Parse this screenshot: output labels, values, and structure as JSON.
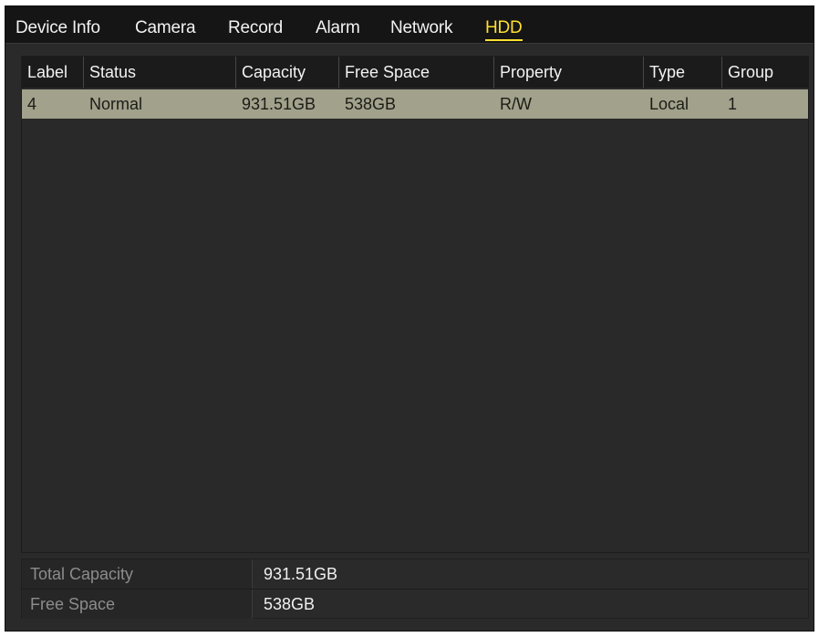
{
  "tabs": [
    {
      "label": "Device Info"
    },
    {
      "label": "Camera"
    },
    {
      "label": "Record"
    },
    {
      "label": "Alarm"
    },
    {
      "label": "Network"
    },
    {
      "label": "HDD",
      "active": true
    }
  ],
  "table": {
    "headers": [
      "Label",
      "Status",
      "Capacity",
      "Free Space",
      "Property",
      "Type",
      "Group"
    ],
    "rows": [
      [
        "4",
        "Normal",
        "931.51GB",
        "538GB",
        "R/W",
        "Local",
        "1"
      ]
    ]
  },
  "summary": {
    "total_capacity_label": "Total Capacity",
    "total_capacity_value": "931.51GB",
    "free_space_label": "Free Space",
    "free_space_value": "538GB"
  },
  "colors": {
    "active_tab": "#ffdf2e",
    "selected_row": "#a1a18c",
    "background": "#2a2a2a"
  }
}
